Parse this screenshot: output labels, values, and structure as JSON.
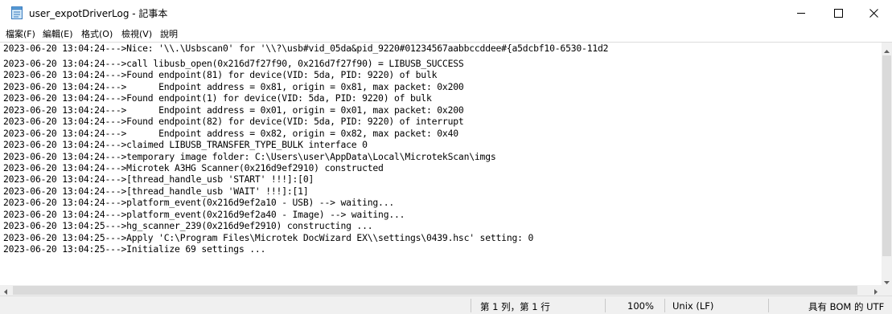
{
  "window": {
    "title": "user_expotDriverLog - 記事本",
    "icon": "notepad-icon",
    "buttons": {
      "minimize": "minimize-icon",
      "maximize": "maximize-icon",
      "close": "close-icon"
    }
  },
  "menu": {
    "file": "檔案(F)",
    "edit": "編輯(E)",
    "format": "格式(O)",
    "view": "檢視(V)",
    "help": "說明"
  },
  "editor": {
    "lines": [
      "2023-06-20 13:04:24--->Nice: '\\\\.\\Usbscan0' for '\\\\?\\usb#vid_05da&pid_9220#01234567aabbccddee#{a5dcbf10-6530-11d2",
      "2023-06-20 13:04:24--->call libusb_open(0x216d7f27f90, 0x216d7f27f90) = LIBUSB_SUCCESS",
      "2023-06-20 13:04:24--->Found endpoint(81) for device(VID: 5da, PID: 9220) of bulk",
      "2023-06-20 13:04:24--->      Endpoint address = 0x81, origin = 0x81, max packet: 0x200",
      "2023-06-20 13:04:24--->Found endpoint(1) for device(VID: 5da, PID: 9220) of bulk",
      "2023-06-20 13:04:24--->      Endpoint address = 0x01, origin = 0x01, max packet: 0x200",
      "2023-06-20 13:04:24--->Found endpoint(82) for device(VID: 5da, PID: 9220) of interrupt",
      "2023-06-20 13:04:24--->      Endpoint address = 0x82, origin = 0x82, max packet: 0x40",
      "2023-06-20 13:04:24--->claimed LIBUSB_TRANSFER_TYPE_BULK interface 0",
      "2023-06-20 13:04:24--->temporary image folder: C:\\Users\\user\\AppData\\Local\\MicrotekScan\\imgs",
      "2023-06-20 13:04:24--->Microtek A3HG Scanner(0x216d9ef2910) constructed",
      "2023-06-20 13:04:24--->[thread_handle_usb 'START' !!!]:[0]",
      "2023-06-20 13:04:24--->[thread_handle_usb 'WAIT' !!!]:[1]",
      "2023-06-20 13:04:24--->platform_event(0x216d9ef2a10 - USB) --> waiting...",
      "2023-06-20 13:04:24--->platform_event(0x216d9ef2a40 - Image) --> waiting...",
      "2023-06-20 13:04:25--->hg_scanner_239(0x216d9ef2910) constructing ...",
      "2023-06-20 13:04:25--->Apply 'C:\\Program Files\\Microtek DocWizard EX\\\\settings\\0439.hsc' setting: 0",
      "2023-06-20 13:04:25--->Initialize 69 settings ..."
    ]
  },
  "status": {
    "position": "第 1 列，第 1 行",
    "zoom": "100%",
    "line_ending": "Unix (LF)",
    "encoding": "具有 BOM 的 UTF"
  }
}
